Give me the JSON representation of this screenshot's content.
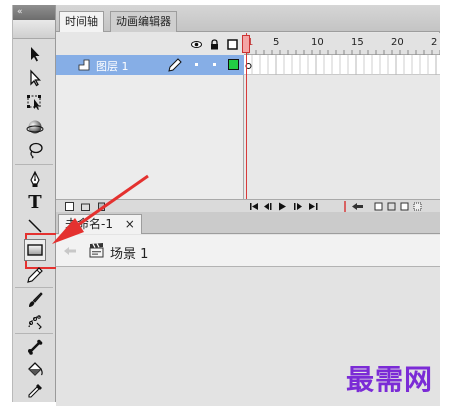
{
  "toolpanel": {
    "collapse_glyph": "«",
    "tools": [
      {
        "name": "selection-tool",
        "icon": "arrow-icon"
      },
      {
        "name": "subselection-tool",
        "icon": "hollow-arrow-icon"
      },
      {
        "name": "free-transform-tool",
        "icon": "transform-icon"
      },
      {
        "name": "3d-rotation-tool",
        "icon": "sphere-icon"
      },
      {
        "name": "lasso-tool",
        "icon": "lasso-icon"
      },
      {
        "name": "pen-tool",
        "icon": "pen-icon"
      },
      {
        "name": "text-tool",
        "icon": "text-icon",
        "label": "T"
      },
      {
        "name": "line-tool",
        "icon": "line-icon"
      },
      {
        "name": "rectangle-tool",
        "icon": "rectangle-icon"
      },
      {
        "name": "pencil-tool",
        "icon": "pencil-icon"
      },
      {
        "name": "brush-tool",
        "icon": "brush-icon"
      },
      {
        "name": "deco-tool",
        "icon": "deco-icon"
      },
      {
        "name": "bone-tool",
        "icon": "bone-icon"
      },
      {
        "name": "paint-bucket-tool",
        "icon": "bucket-icon"
      },
      {
        "name": "eyedropper-tool",
        "icon": "eyedropper-icon"
      }
    ],
    "highlight_color": "#e4312f"
  },
  "timeline": {
    "tabs": [
      {
        "label": "时间轴",
        "active": true
      },
      {
        "label": "动画编辑器",
        "active": false
      }
    ],
    "header_icons": [
      "eye-icon",
      "lock-icon",
      "outline-icon"
    ],
    "frame_ruler": [
      "1",
      "5",
      "10",
      "15",
      "20",
      "2"
    ],
    "layer": {
      "name": "图层 1",
      "color": "#22cc44"
    },
    "selected_row_color": "#86aee6"
  },
  "document": {
    "tab_label": "未命名-1",
    "close_glyph": "×",
    "scene_label": "场景 1"
  },
  "watermark": "最需网",
  "arrow_color": "#e4312f"
}
